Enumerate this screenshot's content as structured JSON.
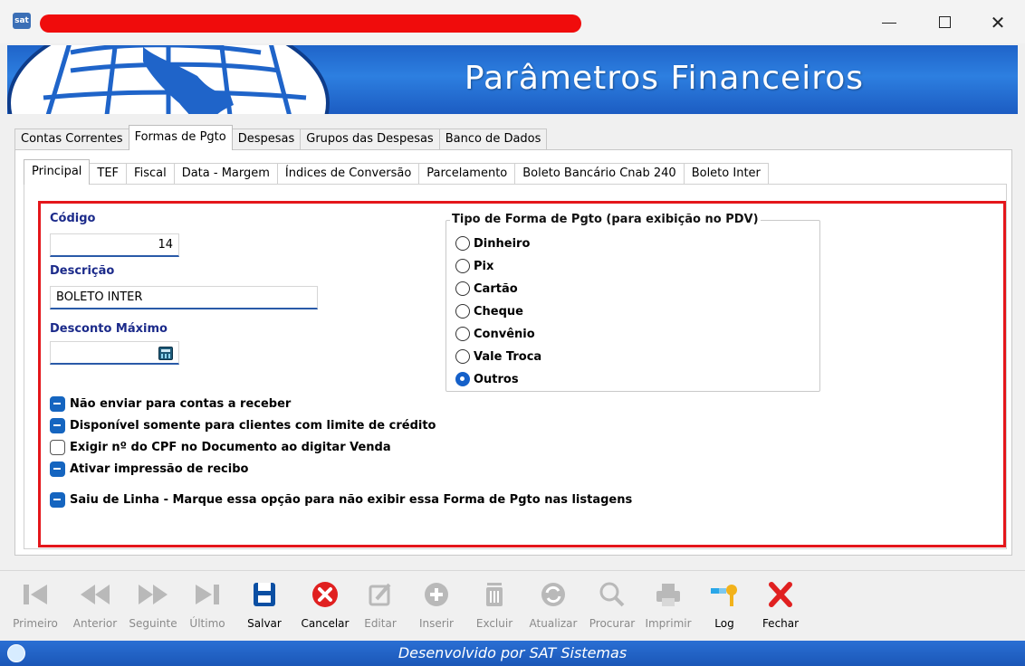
{
  "window": {
    "app_icon_text": "sat",
    "minimize_label": "—",
    "close_label": "✕"
  },
  "banner": {
    "title": "Parâmetros Financeiros"
  },
  "main_tabs": [
    {
      "label": "Contas Correntes",
      "active": false
    },
    {
      "label": "Formas de Pgto",
      "active": true
    },
    {
      "label": "Despesas",
      "active": false
    },
    {
      "label": "Grupos das Despesas",
      "active": false
    },
    {
      "label": "Banco de Dados",
      "active": false
    }
  ],
  "sub_tabs": [
    {
      "label": "Principal",
      "active": true
    },
    {
      "label": "TEF",
      "active": false
    },
    {
      "label": "Fiscal",
      "active": false
    },
    {
      "label": "Data - Margem",
      "active": false
    },
    {
      "label": "Índices de Conversão",
      "active": false
    },
    {
      "label": "Parcelamento",
      "active": false
    },
    {
      "label": "Boleto Bancário Cnab 240",
      "active": false
    },
    {
      "label": "Boleto Inter",
      "active": false
    }
  ],
  "form": {
    "codigo_label": "Código",
    "codigo_value": "14",
    "descricao_label": "Descrição",
    "descricao_value": "BOLETO INTER",
    "desconto_label": "Desconto Máximo",
    "desconto_value": ""
  },
  "tipo_forma": {
    "title": "Tipo de Forma de Pgto (para exibição no PDV)",
    "options": [
      {
        "label": "Dinheiro",
        "checked": false
      },
      {
        "label": "Pix",
        "checked": false
      },
      {
        "label": "Cartão",
        "checked": false
      },
      {
        "label": "Cheque",
        "checked": false
      },
      {
        "label": "Convênio",
        "checked": false
      },
      {
        "label": "Vale Troca",
        "checked": false
      },
      {
        "label": "Outros",
        "checked": true
      }
    ]
  },
  "options": [
    {
      "label": "Não enviar para contas a receber",
      "state": "indeterminate"
    },
    {
      "label": "Disponível somente para clientes com limite de crédito",
      "state": "indeterminate"
    },
    {
      "label": "Exigir nº do CPF no Documento ao digitar Venda",
      "state": "unchecked"
    },
    {
      "label": "Ativar impressão de recibo",
      "state": "indeterminate"
    },
    {
      "label": "Saiu de Linha - Marque essa opção para não exibir essa Forma de Pgto nas listagens",
      "state": "indeterminate"
    }
  ],
  "toolbar": [
    {
      "label": "Primeiro",
      "icon": "first-icon",
      "enabled": false
    },
    {
      "label": "Anterior",
      "icon": "previous-icon",
      "enabled": false
    },
    {
      "label": "Seguinte",
      "icon": "next-icon",
      "enabled": false
    },
    {
      "label": "Último",
      "icon": "last-icon",
      "enabled": false
    },
    {
      "label": "Salvar",
      "icon": "save-icon",
      "enabled": true
    },
    {
      "label": "Cancelar",
      "icon": "cancel-icon",
      "enabled": true
    },
    {
      "label": "Editar",
      "icon": "edit-icon",
      "enabled": false
    },
    {
      "label": "Inserir",
      "icon": "insert-icon",
      "enabled": false
    },
    {
      "label": "Excluir",
      "icon": "delete-icon",
      "enabled": false
    },
    {
      "label": "Atualizar",
      "icon": "refresh-icon",
      "enabled": false
    },
    {
      "label": "Procurar",
      "icon": "search-icon",
      "enabled": false
    },
    {
      "label": "Imprimir",
      "icon": "print-icon",
      "enabled": false
    },
    {
      "label": "Log",
      "icon": "key-icon",
      "enabled": true
    },
    {
      "label": "Fechar",
      "icon": "close-icon",
      "enabled": true
    }
  ],
  "statusbar": {
    "text": "Desenvolvido por SAT Sistemas"
  },
  "colors": {
    "accent_blue": "#1f64c9",
    "highlight_red": "#e4161b",
    "label_navy": "#1b2a8a",
    "cancel_red": "#e02020",
    "save_blue": "#0b4fa3"
  }
}
